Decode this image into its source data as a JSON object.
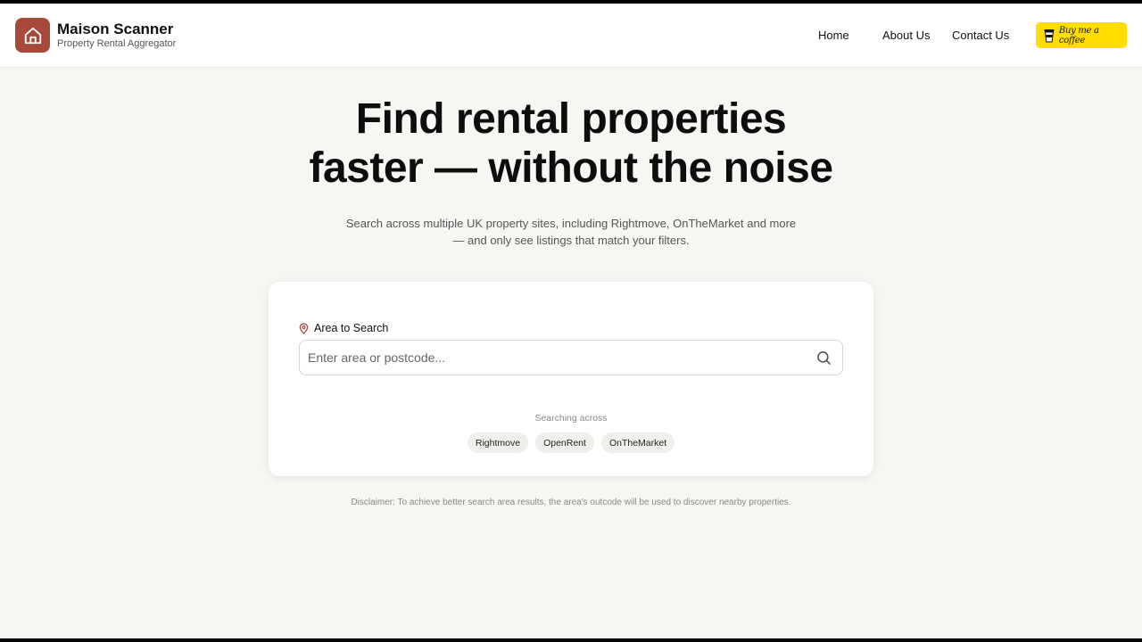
{
  "brand": {
    "title": "Maison Scanner",
    "subtitle": "Property Rental Aggregator",
    "logo_icon": "house-icon",
    "logo_color": "#a8493c"
  },
  "nav": {
    "home": "Home",
    "about": "About Us",
    "contact": "Contact Us"
  },
  "coffee": {
    "label": "Buy me a coffee",
    "icon": "coffee-cup-icon",
    "color": "#ffdd00"
  },
  "hero": {
    "title_line1": "Find rental properties",
    "title_line2": "faster — without the noise",
    "subtitle_line1": "Search across multiple UK property sites, including Rightmove, OnTheMarket and more",
    "subtitle_line2": "— and only see listings that match your filters."
  },
  "search": {
    "label": "Area to Search",
    "label_icon": "map-pin-icon",
    "placeholder": "Enter area or postcode...",
    "value": "",
    "searching_across": "Searching across",
    "sources": [
      "Rightmove",
      "OpenRent",
      "OnTheMarket"
    ]
  },
  "disclaimer": "Disclaimer: To achieve better search area results, the area's outcode will be used to discover nearby properties."
}
